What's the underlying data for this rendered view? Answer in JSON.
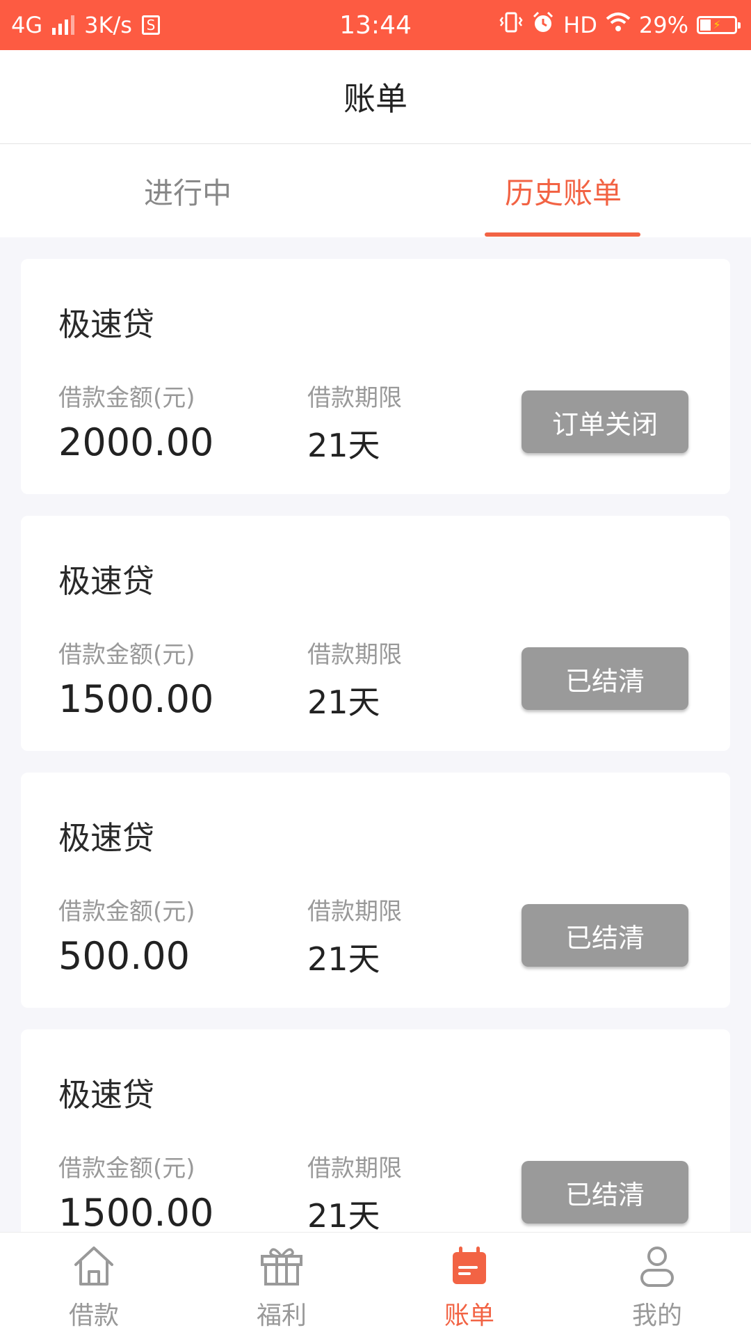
{
  "status_bar": {
    "network": "4G",
    "speed": "3K/s",
    "sim_icon_label": "S",
    "time": "13:44",
    "hd": "HD",
    "battery": "29%"
  },
  "header": {
    "title": "账单"
  },
  "tabs": [
    {
      "label": "进行中",
      "active": false
    },
    {
      "label": "历史账单",
      "active": true
    }
  ],
  "cards": [
    {
      "product": "极速贷",
      "amount_label": "借款金额(元)",
      "amount": "2000.00",
      "term_label": "借款期限",
      "term": "21天",
      "status": "订单关闭"
    },
    {
      "product": "极速贷",
      "amount_label": "借款金额(元)",
      "amount": "1500.00",
      "term_label": "借款期限",
      "term": "21天",
      "status": "已结清"
    },
    {
      "product": "极速贷",
      "amount_label": "借款金额(元)",
      "amount": "500.00",
      "term_label": "借款期限",
      "term": "21天",
      "status": "已结清"
    },
    {
      "product": "极速贷",
      "amount_label": "借款金额(元)",
      "amount": "1500.00",
      "term_label": "借款期限",
      "term": "21天",
      "status": "已结清"
    }
  ],
  "bottom_nav": [
    {
      "label": "借款",
      "icon": "home-icon",
      "active": false
    },
    {
      "label": "福利",
      "icon": "gift-icon",
      "active": false
    },
    {
      "label": "账单",
      "icon": "bill-calendar-icon",
      "active": true
    },
    {
      "label": "我的",
      "icon": "person-icon",
      "active": false
    }
  ],
  "colors": {
    "accent": "#f26344",
    "status_bar": "#fd5b42",
    "status_button": "#9a9a9a",
    "background": "#f6f6fa"
  }
}
